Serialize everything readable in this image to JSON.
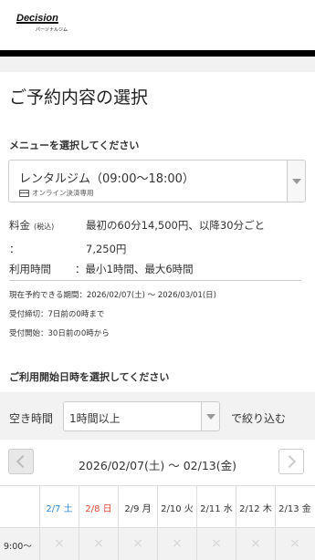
{
  "header": {
    "logo_main": "Decision",
    "logo_sub": "パーソナルジム"
  },
  "page_title": "ご予約内容の選択",
  "menu_section": {
    "label": "メニューを選択してください",
    "selected_name": "レンタルジム（09:00〜18:00）",
    "selected_sub": "オンライン決済専用"
  },
  "pricing": {
    "price_label": "料金",
    "price_label_note": "(税込)",
    "price_text": "最初の60分14,500円、以降30分ごと",
    "price_cont_prefix": "：",
    "price_cont": "7,250円",
    "usage_label": "利用時間",
    "usage_text": "：最小1時間、最大6時間"
  },
  "notes": {
    "period": "現在予約できる期間：2026/02/07(土) 〜 2026/03/01(日)",
    "deadline": "受付締切：7日前の0時まで",
    "start": "受付開始：30日前の0時から"
  },
  "date_section": {
    "label": "ご利用開始日時を選択してください"
  },
  "filter": {
    "label": "空き時間",
    "value": "1時間以上",
    "suffix": "で絞り込む"
  },
  "week": {
    "range": "2026/02/07(土) 〜 02/13(金)"
  },
  "calendar": {
    "days": [
      "2/7 土",
      "2/8 日",
      "2/9 月",
      "2/10 火",
      "2/11 水",
      "2/12 木",
      "2/13 金"
    ],
    "first_time_slot": "9:00〜",
    "unavailable_mark": "×",
    "colors": {
      "saturday": "#2f86d6",
      "sunday": "#e0463a"
    }
  }
}
